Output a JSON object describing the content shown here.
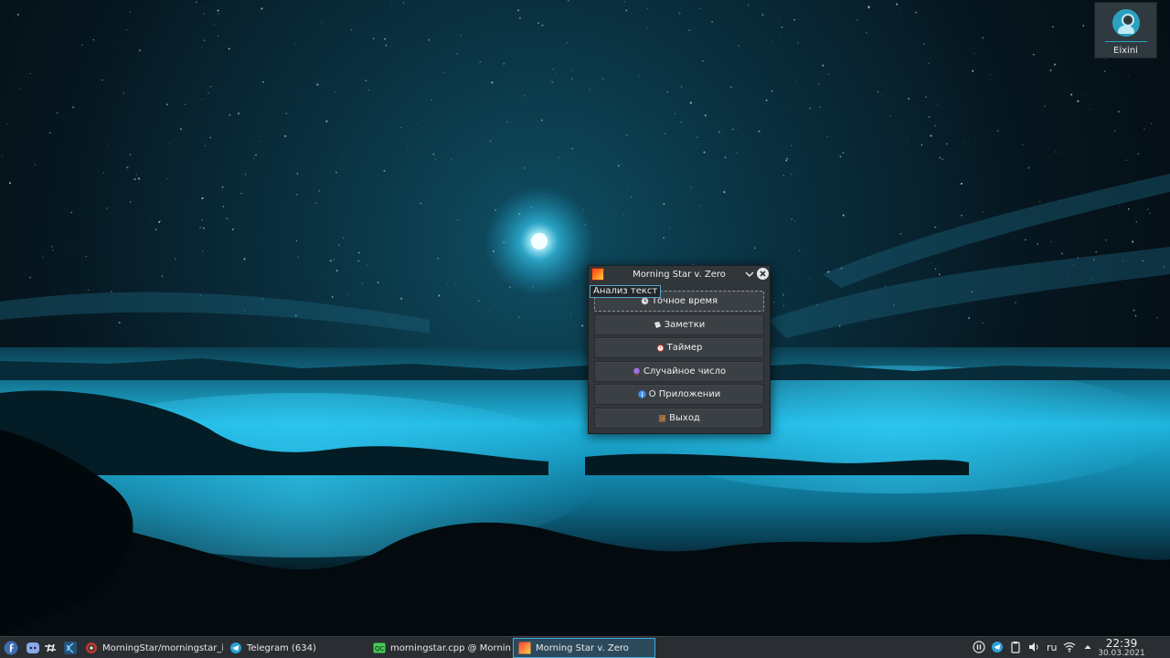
{
  "desktop": {
    "user_name": "Eixini"
  },
  "window": {
    "title": "Morning Star v. Zero",
    "tooltip": "Анализ текст",
    "buttons": [
      {
        "label": "Точное время",
        "icon": "clock-icon"
      },
      {
        "label": "Заметки",
        "icon": "notes-icon"
      },
      {
        "label": "Таймер",
        "icon": "timer-icon"
      },
      {
        "label": "Случайное число",
        "icon": "crystal-ball-icon"
      },
      {
        "label": "О Приложении",
        "icon": "info-icon"
      },
      {
        "label": "Выход",
        "icon": "exit-door-icon"
      }
    ]
  },
  "taskbar": {
    "tasks": [
      {
        "label": "MorningStar/morningstar_im...",
        "icon": "browser-icon"
      },
      {
        "label": "Telegram (634)",
        "icon": "telegram-icon",
        "badge": "634"
      },
      {
        "label": "morningstar.cpp @ Morning...",
        "icon": "qtcreator-icon"
      },
      {
        "label": "Morning Star v. Zero",
        "icon": "morningstar-app-icon"
      }
    ],
    "keyboard_layout": "ru",
    "clock": {
      "time": "22:39",
      "date": "30.03.2021"
    }
  },
  "colors": {
    "accent": "#3daee9",
    "window_bg": "#31363b",
    "panel_bg": "#2a2e32"
  }
}
